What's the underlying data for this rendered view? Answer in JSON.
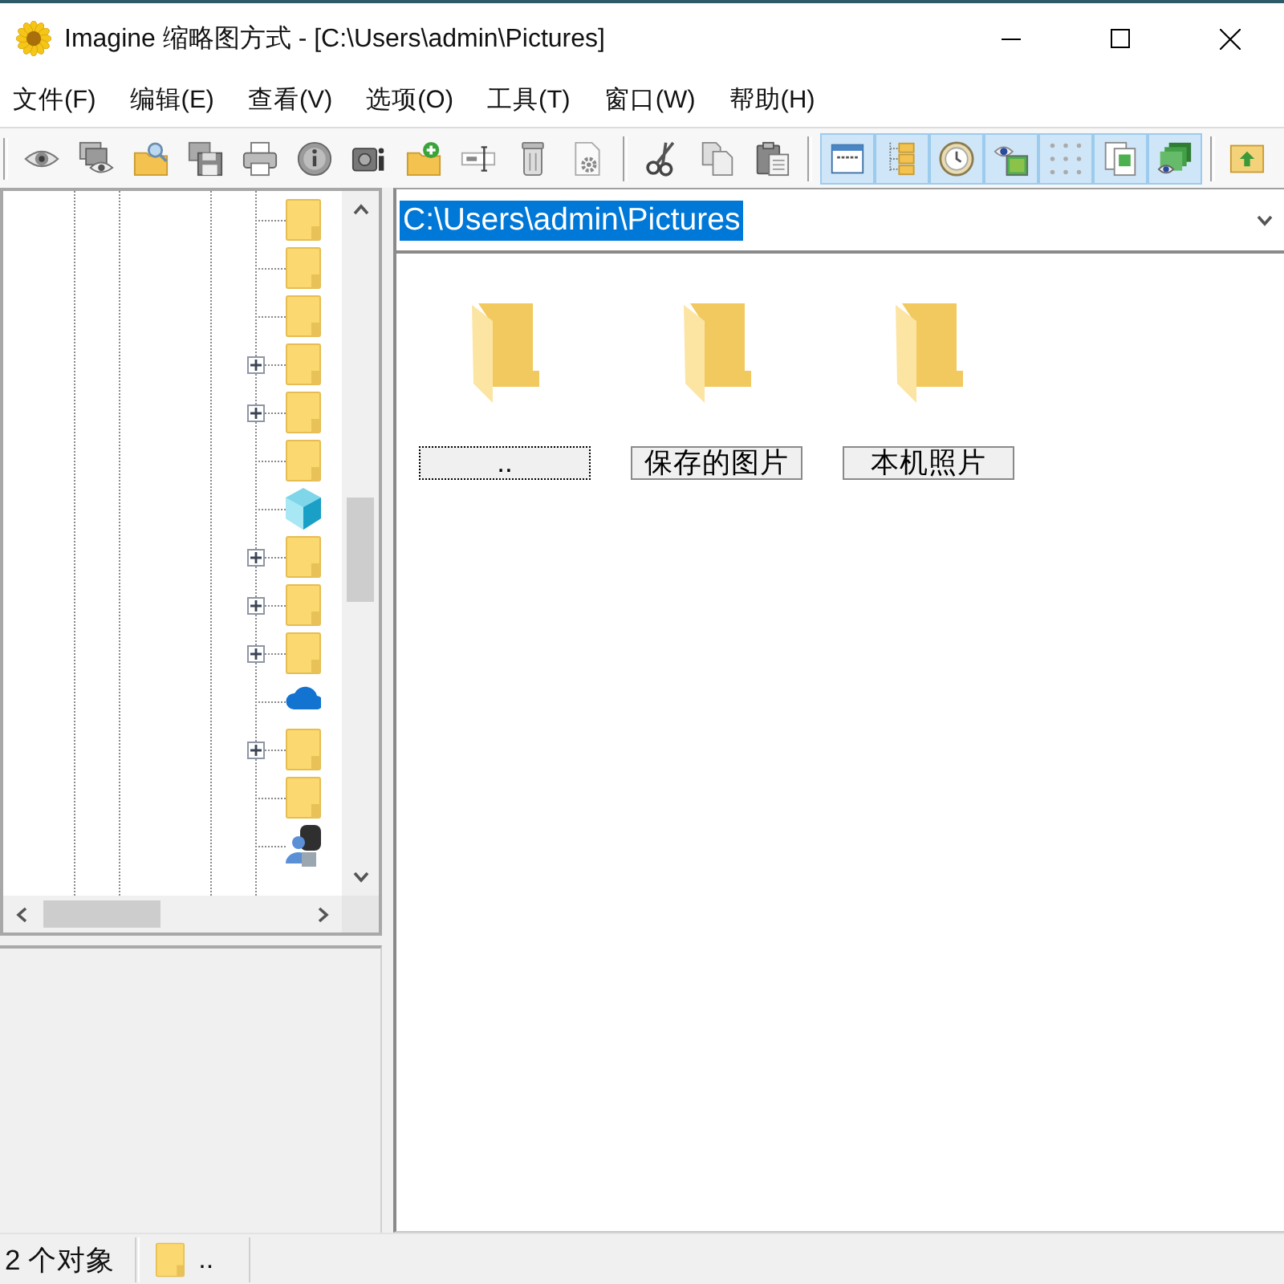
{
  "window": {
    "title": "Imagine 缩略图方式 - [C:\\Users\\admin\\Pictures]"
  },
  "menu": [
    "文件(F)",
    "编辑(E)",
    "查看(V)",
    "选项(O)",
    "工具(T)",
    "窗口(W)",
    "帮助(H)"
  ],
  "toolbar": [
    {
      "buttons": [
        {
          "pressed": false
        },
        {
          "pressed": false
        },
        {
          "pressed": false
        },
        {
          "pressed": false
        },
        {
          "pressed": false
        },
        {
          "pressed": false
        },
        {
          "pressed": false
        },
        {
          "pressed": false
        },
        {
          "pressed": false
        },
        {
          "pressed": false
        },
        {
          "pressed": false
        }
      ]
    },
    {
      "buttons": [
        {
          "pressed": false
        },
        {
          "pressed": false
        },
        {
          "pressed": false
        }
      ]
    },
    {
      "buttons": [
        {
          "pressed": true
        },
        {
          "pressed": true
        },
        {
          "pressed": true
        },
        {
          "pressed": true
        },
        {
          "pressed": true
        },
        {
          "pressed": true
        },
        {
          "pressed": true
        }
      ]
    },
    {
      "buttons": [
        {
          "pressed": false
        }
      ]
    }
  ],
  "tree": {
    "items": [
      {
        "kind": "folder",
        "expandable": false
      },
      {
        "kind": "folder",
        "expandable": false
      },
      {
        "kind": "folder",
        "expandable": false
      },
      {
        "kind": "folder",
        "expandable": true
      },
      {
        "kind": "folder",
        "expandable": true
      },
      {
        "kind": "folder",
        "expandable": false
      },
      {
        "kind": "cube",
        "expandable": false
      },
      {
        "kind": "folder",
        "expandable": true
      },
      {
        "kind": "folder",
        "expandable": true
      },
      {
        "kind": "folder",
        "expandable": true
      },
      {
        "kind": "cloud",
        "expandable": false
      },
      {
        "kind": "folder",
        "expandable": true
      },
      {
        "kind": "folder",
        "expandable": false
      },
      {
        "kind": "user",
        "expandable": false
      }
    ]
  },
  "address": {
    "value": "C:\\Users\\admin\\Pictures",
    "selected": true
  },
  "thumbnails": [
    {
      "label": "..",
      "focused": true
    },
    {
      "label": "保存的图片",
      "focused": false
    },
    {
      "label": "本机照片",
      "focused": false
    }
  ],
  "status_bar": {
    "count": "2 个对象",
    "current": ".."
  }
}
